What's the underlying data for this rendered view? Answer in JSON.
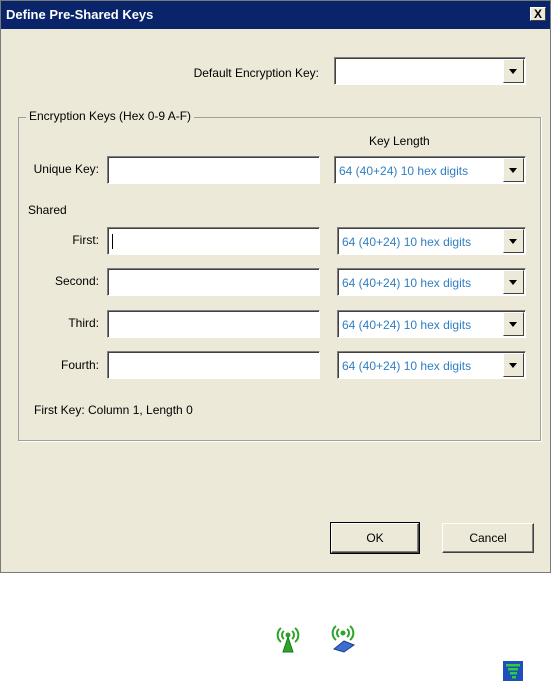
{
  "dialog": {
    "title": "Define Pre-Shared Keys",
    "close_glyph": "X",
    "default_key_label": "Default Encryption Key:",
    "default_key_value": "",
    "group_title": "Encryption Keys (Hex 0-9 A-F)",
    "key_length_header": "Key Length",
    "unique_key": {
      "label": "Unique Key:",
      "value": "",
      "length": "64  (40+24)  10 hex digits"
    },
    "shared_label": "Shared",
    "shared_keys": [
      {
        "label": "First:",
        "value": "",
        "length": "64  (40+24)  10 hex digits"
      },
      {
        "label": "Second:",
        "value": "",
        "length": "64  (40+24)  10 hex digits"
      },
      {
        "label": "Third:",
        "value": "",
        "length": "64  (40+24)  10 hex digits"
      },
      {
        "label": "Fourth:",
        "value": "",
        "length": "64  (40+24)  10 hex digits"
      }
    ],
    "status_text": "First Key: Column 1,  Length 0",
    "ok_label": "OK",
    "cancel_label": "Cancel"
  },
  "tray_icons": [
    "wireless-signal-icon",
    "network-connect-icon",
    "signal-strength-icon"
  ],
  "colors": {
    "title_bar": "#0a246a",
    "dialog_bg": "#ece9d8",
    "combo_text": "#2f7fc1",
    "icon_green": "#2aa52a"
  }
}
